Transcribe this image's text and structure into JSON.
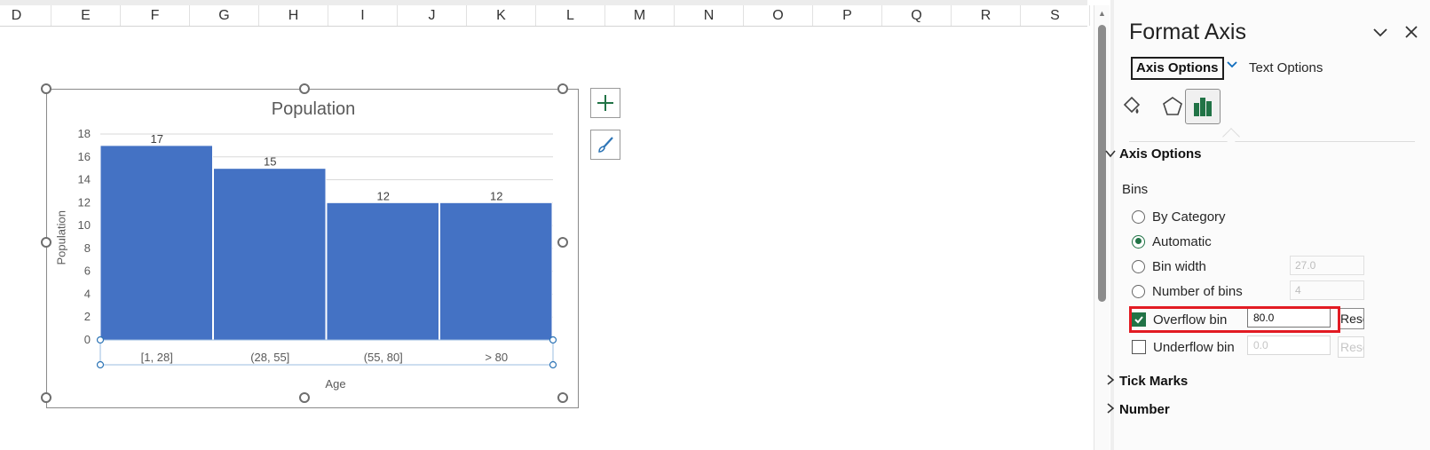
{
  "sheet": {
    "columns": [
      "D",
      "E",
      "F",
      "G",
      "H",
      "I",
      "J",
      "K",
      "L",
      "M",
      "N",
      "O",
      "P",
      "Q",
      "R",
      "S"
    ]
  },
  "chart": {
    "chart_data": {
      "type": "bar",
      "title": "Population",
      "xlabel": "Age",
      "ylabel": "Population",
      "categories": [
        "[1, 28]",
        "(28, 55]",
        "(55, 80]",
        "> 80"
      ],
      "values": [
        17,
        15,
        12,
        12
      ],
      "ylim": [
        0,
        18
      ],
      "yticks": [
        0,
        2,
        4,
        6,
        8,
        10,
        12,
        14,
        16,
        18
      ],
      "grid": true,
      "bar_color": "#4472C4"
    },
    "side_buttons": [
      "chart-elements-icon",
      "chart-styles-icon"
    ]
  },
  "panel": {
    "title": "Format Axis",
    "tabs": {
      "axis_options": "Axis Options",
      "text_options": "Text Options"
    },
    "section_axis": "Axis Options",
    "bins_label": "Bins",
    "radio_options": [
      {
        "label": "By Category",
        "checked": false
      },
      {
        "label": "Automatic",
        "checked": true
      },
      {
        "label": "Bin width",
        "checked": false,
        "value": "27.0"
      },
      {
        "label": "Number of bins",
        "checked": false,
        "value": "4"
      }
    ],
    "overflow": {
      "label": "Overflow bin",
      "checked": true,
      "value": "80.0",
      "reset": "Reset"
    },
    "underflow": {
      "label": "Underflow bin",
      "checked": false,
      "value": "0.0",
      "reset": "Reset"
    },
    "section_tick": "Tick Marks",
    "section_number": "Number",
    "accent_color": "#217346",
    "highlight_color": "#e21b23"
  }
}
